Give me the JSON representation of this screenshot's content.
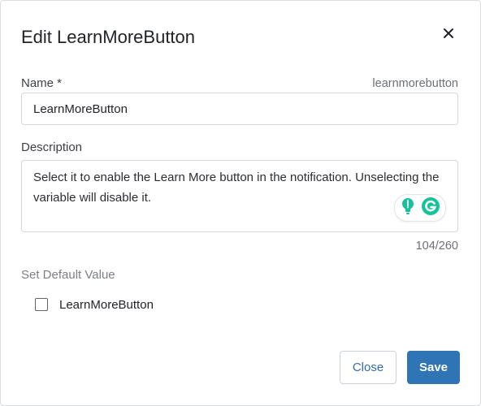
{
  "dialog": {
    "title": "Edit LearnMoreButton",
    "close_icon": "close-icon"
  },
  "name_field": {
    "label": "Name *",
    "key_hint": "learnmorebutton",
    "value": "LearnMoreButton"
  },
  "description_field": {
    "label": "Description",
    "value": "Select it to enable the Learn More button in the notification. Unselecting the variable will disable it.",
    "counter": "104/260",
    "assist_icons": [
      "lightbulb-icon",
      "grammarly-icon"
    ]
  },
  "default_value": {
    "section_label": "Set Default Value",
    "checkbox_label": "LearnMoreButton",
    "checked": false
  },
  "footer": {
    "close_label": "Close",
    "save_label": "Save"
  },
  "colors": {
    "primary": "#2f74b5",
    "grammarly_green": "#15c39a",
    "border": "#d3d7dc"
  }
}
